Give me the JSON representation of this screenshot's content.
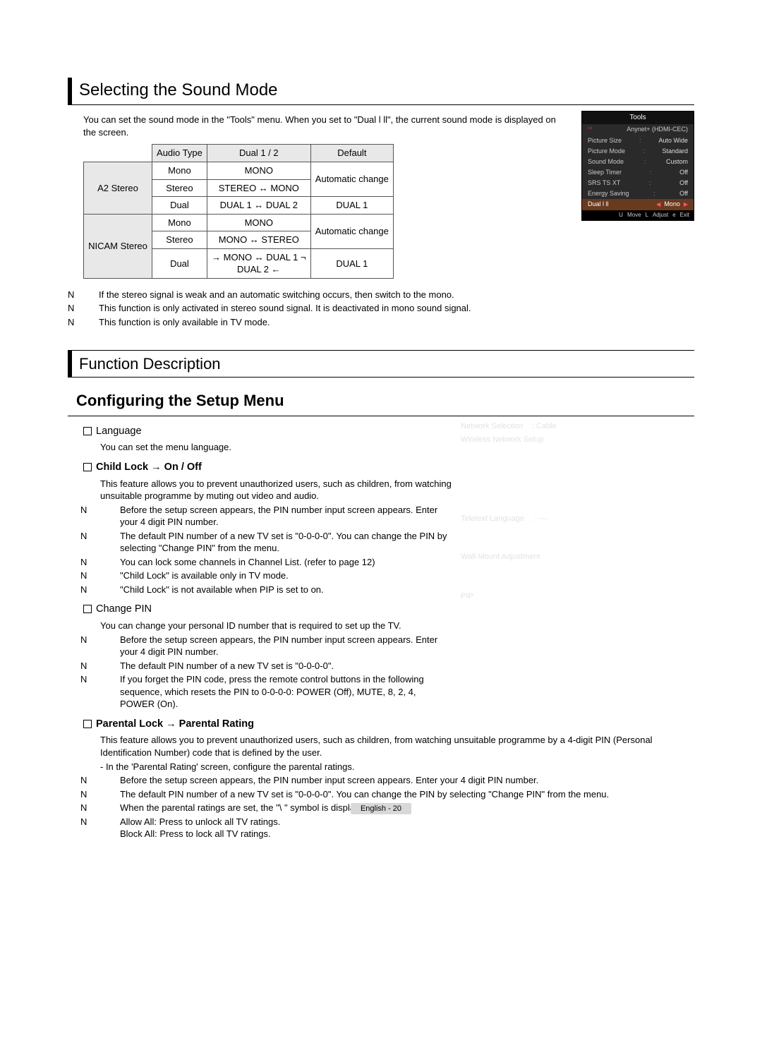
{
  "section1_title": "Selecting the Sound Mode",
  "section1_intro": "You can set the sound mode in the \"Tools\" menu. When you set to \"Dual l ll\", the current sound mode is displayed on the screen.",
  "table": {
    "h_audio_type": "Audio Type",
    "h_dual": "Dual 1 / 2",
    "h_default": "Default",
    "a2": "A2 Stereo",
    "nicam": "NICAM Stereo",
    "r1_c1": "Mono",
    "r1_c2": "MONO",
    "r1_c3": "Automatic change",
    "r2_c1": "Stereo",
    "r2_c2": "STEREO ↔ MONO",
    "r3_c1": "Dual",
    "r3_c2": "DUAL 1 ↔ DUAL 2",
    "r3_c3": "DUAL 1",
    "r4_c1": "Mono",
    "r4_c2": "MONO",
    "r4_c3": "Automatic change",
    "r5_c1": "Stereo",
    "r5_c2": "MONO ↔ STEREO",
    "r6_c1": "Dual",
    "r6_c2_line1": "→ MONO ↔ DUAL 1 ¬",
    "r6_c2_line2": " DUAL 2  ←",
    "r6_c3": "DUAL 1"
  },
  "tools_osd": {
    "title": "Tools",
    "anynet": "Anynet+ (HDMI-CEC)",
    "rows": [
      {
        "label": "Picture Size",
        "val": "Auto Wide"
      },
      {
        "label": "Picture Mode",
        "val": "Standard"
      },
      {
        "label": "Sound Mode",
        "val": "Custom"
      },
      {
        "label": "Sleep Timer",
        "val": "Off"
      },
      {
        "label": "SRS TS XT",
        "val": "Off"
      },
      {
        "label": "Energy Saving",
        "val": "Off"
      }
    ],
    "sel_label": "Dual l ll",
    "sel_val": "Mono",
    "foot_u": "U",
    "foot_move": "Move",
    "foot_l": "L",
    "foot_adjust": "Adjust",
    "foot_e": "e",
    "foot_exit": "Exit"
  },
  "s1_notes": [
    "If the stereo signal is weak and an automatic switching occurs, then switch to the mono.",
    "This function is only activated in stereo sound signal. It is deactivated in mono sound signal.",
    "This function is only available in TV mode."
  ],
  "section2_title": "Function Description",
  "section2_h2": "Configuring the Setup Menu",
  "lang_title": "Language",
  "lang_body": "You can set the menu language.",
  "childlock_title": "Child Lock → On / Off",
  "childlock_intro": "This feature allows you to prevent unauthorized users, such as children, from watching unsuitable programme by muting out video and audio.",
  "childlock_notes": [
    "Before the setup screen appears, the PIN number input screen appears. Enter your 4 digit PIN number.",
    "The default PIN number of a new TV set is \"0-0-0-0\". You can change the PIN by selecting \"Change PIN\" from the menu.",
    "You can lock some channels in Channel List. (refer to page 12)",
    "\"Child Lock\" is available only in TV mode.",
    "\"Child Lock\" is not available when PIP is set to on."
  ],
  "changepin_title": "Change PIN",
  "changepin_intro": "You can change your personal ID number that is required to set up the TV.",
  "changepin_notes": [
    "Before the setup screen appears, the PIN number input screen appears. Enter your 4 digit PIN number.",
    "The default PIN number of a new TV set is \"0-0-0-0\".",
    "If you forget the PIN code, press the remote control buttons in the following sequence, which resets the PIN to 0-0-0-0: POWER (Off), MUTE, 8, 2, 4, POWER (On)."
  ],
  "parental_title": "Parental Lock → Parental Rating",
  "parental_intro": "This feature allows you to prevent unauthorized users, such as children, from watching unsuitable programme by a 4-digit PIN (Personal Identification Number) code that is defined by the user.",
  "parental_sub": "-  In the 'Parental Rating' screen, configure the parental ratings.",
  "parental_notes": [
    "Before the setup screen appears, the PIN number input screen appears. Enter your 4 digit PIN number.",
    "The default PIN number of a new TV set is \"0-0-0-0\". You can change the PIN by selecting \"Change PIN\" from the menu.",
    "When the parental ratings are set, the \"\\  \" symbol is displayed.",
    "Allow All: Press to unlock all TV ratings.\nBlock All: Press to lock all TV ratings."
  ],
  "faint": {
    "net_sel_l": "Network Selection",
    "net_sel_v": ": Cable",
    "wireless": "Wireless Network Setup",
    "teletext_l": "Teletext Language",
    "teletext_v": ": ----",
    "wallmount": "Wall-Mount Adjustment",
    "pip": "PIP"
  },
  "n_mark": "N",
  "page_footer": "English - 20"
}
